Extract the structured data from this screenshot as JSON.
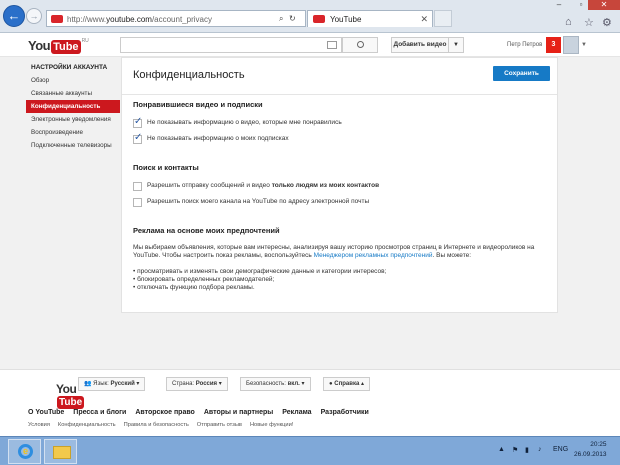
{
  "browser": {
    "url_prefix": "http://www.",
    "url_domain": "youtube.com",
    "url_path": "/account_privacy",
    "tab_title": "YouTube",
    "search_ctl": "⌕",
    "refresh_ctl": "↻",
    "close_ctl": "✕"
  },
  "header": {
    "logo_you": "You",
    "logo_tube": "Tube",
    "logo_region": "RU",
    "search_placeholder": "",
    "upload_label": "Добавить видео",
    "upload_arrow": "▼",
    "username": "Петр Петров",
    "notif_count": "3",
    "avatar_caret": "▼"
  },
  "sidebar": {
    "title": "НАСТРОЙКИ АККАУНТА",
    "items": [
      {
        "label": "Обзор"
      },
      {
        "label": "Связанные аккаунты"
      },
      {
        "label": "Конфиденциальность"
      },
      {
        "label": "Электронные уведомления"
      },
      {
        "label": "Воспроизведение"
      },
      {
        "label": "Подключенные телевизоры"
      }
    ]
  },
  "main": {
    "title": "Конфиденциальность",
    "save_label": "Сохранить",
    "likes_section": {
      "title": "Понравившиеся видео и подписки",
      "options": [
        {
          "label": "Не показывать информацию о видео, которые мне понравились",
          "checked": true
        },
        {
          "label": "Не показывать информацию о моих подписках",
          "checked": true
        }
      ]
    },
    "search_section": {
      "title": "Поиск и контакты",
      "option1_label": "Разрешить отправку сообщений и видео ",
      "option1_bold": "только людям из моих контактов",
      "option2_label": "Разрешить поиск моего канала на YouTube по адресу электронной почты"
    },
    "ads_section": {
      "title": "Реклама на основе моих предпочтений",
      "description": "Мы выбираем объявления, которые вам интересны, анализируя вашу историю просмотров страниц в Интернете и видеороликов на YouTube. Чтобы настроить показ рекламы, воспользуйтесь ",
      "link": "Менеджером рекламных предпочтений",
      "description_end": ". Вы можете:",
      "bullets": [
        "просматривать и изменять свои демографические данные и категории интересов;",
        "блокировать определенных рекламодателей;",
        "отключать функцию подбора рекламы."
      ]
    }
  },
  "footer": {
    "language_prefix": "Язык: ",
    "language_value": "Русский",
    "country_prefix": "Страна: ",
    "country_value": "Россия",
    "safety_prefix": "Безопасность: ",
    "safety_value": "вкл.",
    "help_label": "Справка",
    "links_primary": [
      "О YouTube",
      "Пресса и блоги",
      "Авторское право",
      "Авторы и партнеры",
      "Реклама",
      "Разработчики"
    ],
    "links_secondary": [
      "Условия",
      "Конфиденциальность",
      "Правила и безопасность",
      "Отправить отзыв",
      "Новые функции!"
    ]
  },
  "taskbar": {
    "lang": "ENG",
    "time": "20:25",
    "date": "26.09.2013"
  }
}
